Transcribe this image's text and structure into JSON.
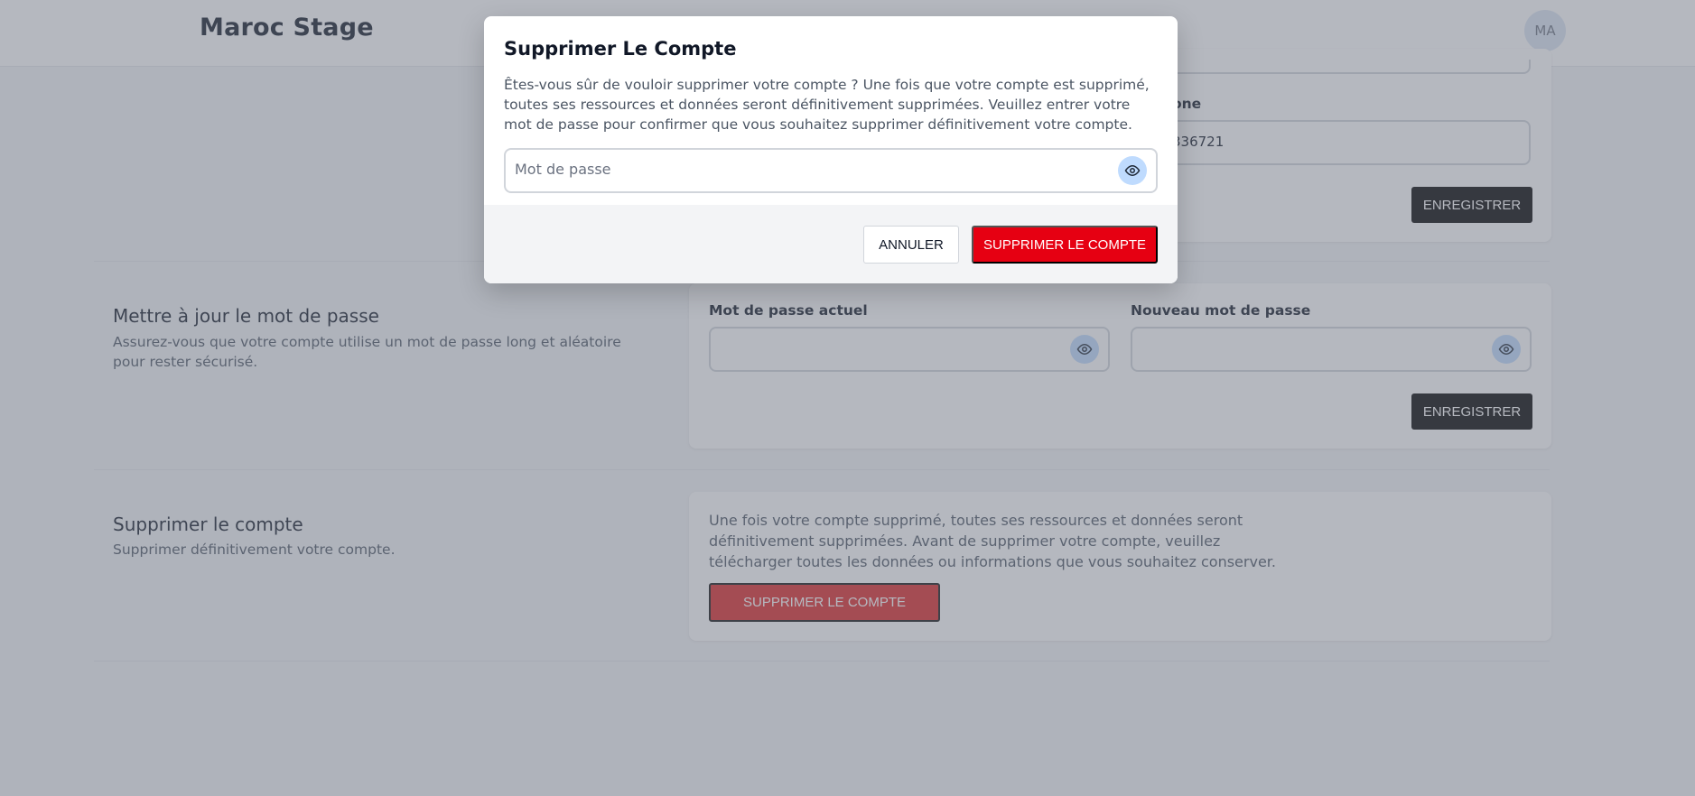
{
  "header": {
    "brand": "Maroc Stage",
    "avatar_initials": "MA"
  },
  "profile_section": {
    "phone_label_partial": "one",
    "phone_value_partial": "336721",
    "save_label": "ENREGISTRER"
  },
  "password_section": {
    "title": "Mettre à jour le mot de passe",
    "description": "Assurez-vous que votre compte utilise un mot de passe long et aléatoire pour rester sécurisé.",
    "current_label": "Mot de passe actuel",
    "new_label": "Nouveau mot de passe",
    "save_label": "ENREGISTRER"
  },
  "delete_section": {
    "title": "Supprimer le compte",
    "description": "Supprimer définitivement votre compte.",
    "card_text": "Une fois votre compte supprimé, toutes ses ressources et données seront définitivement supprimées. Avant de supprimer votre compte, veuillez télécharger toutes les données ou informations que vous souhaitez conserver.",
    "button_label": "SUPPRIMER LE COMPTE"
  },
  "modal": {
    "title": "Supprimer Le Compte",
    "text": "Êtes-vous sûr de vouloir supprimer votre compte ? Une fois que votre compte est supprimé, toutes ses ressources et données seront définitivement supprimées. Veuillez entrer votre mot de passe pour confirmer que vous souhaitez supprimer définitivement votre compte.",
    "password_placeholder": "Mot de passe",
    "cancel_label": "ANNULER",
    "delete_label": "SUPPRIMER LE COMPTE"
  },
  "colors": {
    "delete_accent": "#e60012",
    "eye_button": "#bfdbfe",
    "dark_button": "#000000"
  },
  "icons": [
    "eye-icon"
  ]
}
